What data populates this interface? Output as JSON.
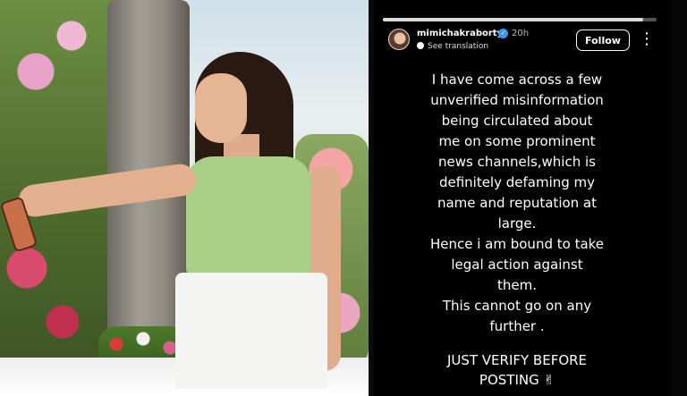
{
  "story": {
    "username": "mimichakraborty",
    "time": "20h",
    "see_translation": "See translation",
    "follow_label": "Follow",
    "more_label": "⋮",
    "progress": 0.95,
    "lines": [
      "I have come across a few",
      "unverified misinformation",
      "being circulated about",
      "me on some prominent",
      "news channels,which is",
      "definitely defaming my",
      "name and reputation at",
      "large.",
      "Hence i am bound to take",
      "legal action against",
      "them.",
      "This cannot go on any",
      "further ."
    ],
    "closing_line1": "JUST VERIFY BEFORE",
    "closing_line2": "POSTING ✌"
  }
}
